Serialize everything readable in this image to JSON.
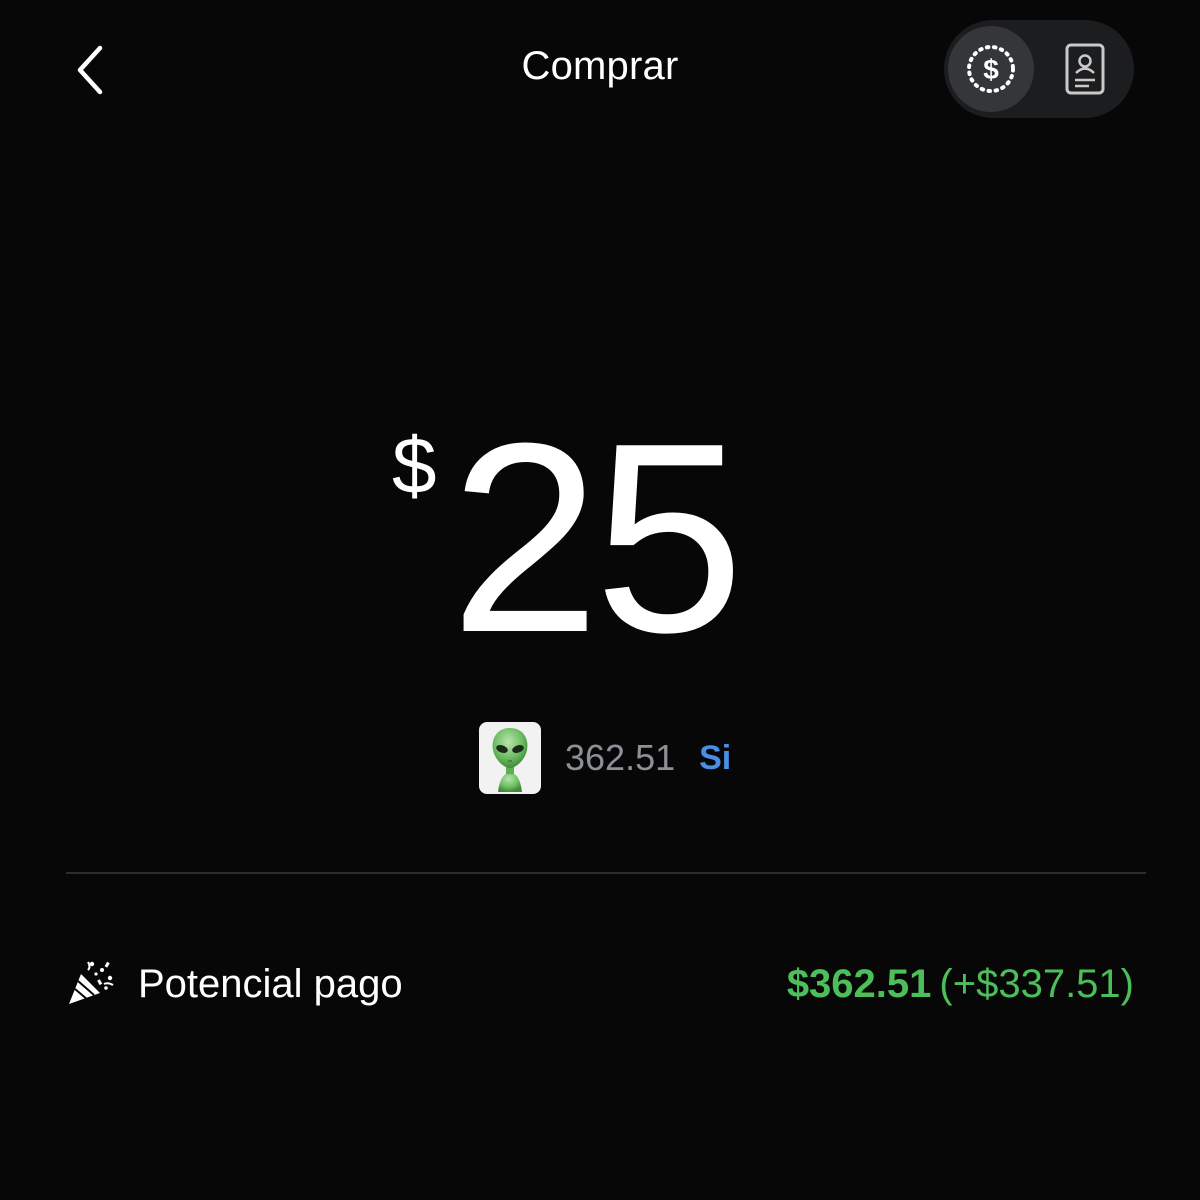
{
  "header": {
    "title": "Comprar",
    "toggle": {
      "selected": "dollar",
      "options": [
        {
          "icon": "dollar-coin-icon",
          "active": true
        },
        {
          "icon": "shares-card-icon",
          "active": false
        }
      ]
    }
  },
  "order": {
    "currency_symbol": "$",
    "amount": "25"
  },
  "outcome": {
    "avatar_icon": "alien-icon",
    "price": "362.51",
    "side": "Si"
  },
  "payout": {
    "icon": "party-popper-icon",
    "label": "Potencial pago",
    "amount": "$362.51",
    "delta": "(+$337.51)"
  },
  "colors": {
    "background": "#070707",
    "accent_green": "#4cbf5a",
    "accent_blue": "#4a8fe7",
    "muted_text": "#8e9097",
    "toggle_bg": "#1c1d1f",
    "toggle_active": "#34363a",
    "divider": "#2c2d30"
  }
}
